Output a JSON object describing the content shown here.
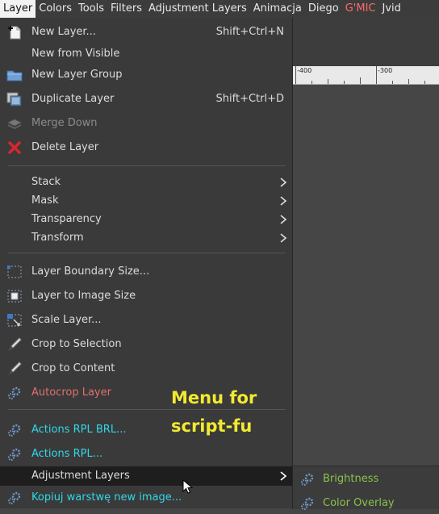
{
  "menubar": {
    "items": [
      "Layer",
      "Colors",
      "Tools",
      "Filters",
      "Adjustment Layers",
      "Animacja",
      "Diego",
      "G'MIC",
      "Jvid"
    ]
  },
  "ruler": {
    "labels": [
      "-400",
      "-300"
    ]
  },
  "annotation": {
    "line1": "Menu for",
    "line2": "script-fu"
  },
  "layer_menu": {
    "new_layer": {
      "label": "New Layer...",
      "shortcut": "Shift+Ctrl+N",
      "icon": "new-layer-icon"
    },
    "new_from_visible": {
      "label": "New from Visible"
    },
    "new_layer_group": {
      "label": "New Layer Group",
      "icon": "folder-icon"
    },
    "duplicate_layer": {
      "label": "Duplicate Layer",
      "shortcut": "Shift+Ctrl+D",
      "icon": "duplicate-icon"
    },
    "merge_down": {
      "label": "Merge Down",
      "icon": "merge-down-icon",
      "enabled": false
    },
    "delete_layer": {
      "label": "Delete Layer",
      "icon": "delete-icon"
    },
    "stack": {
      "label": "Stack"
    },
    "mask": {
      "label": "Mask"
    },
    "transparency": {
      "label": "Transparency"
    },
    "transform": {
      "label": "Transform"
    },
    "layer_boundary_size": {
      "label": "Layer Boundary Size...",
      "icon": "layer-boundary-icon"
    },
    "layer_to_image_size": {
      "label": "Layer to Image Size",
      "icon": "layer-to-image-icon"
    },
    "scale_layer": {
      "label": "Scale Layer...",
      "icon": "scale-icon"
    },
    "crop_to_selection": {
      "label": "Crop to Selection",
      "icon": "knife-icon"
    },
    "crop_to_content": {
      "label": "Crop to Content",
      "icon": "knife-icon"
    },
    "autocrop_layer": {
      "label": "Autocrop Layer",
      "icon": "gear-icon"
    },
    "actions_rpl_brl": {
      "label": "Actions RPL BRL...",
      "icon": "gear-icon"
    },
    "actions_rpl": {
      "label": "Actions RPL...",
      "icon": "gear-icon"
    },
    "adjustment_layers": {
      "label": "Adjustment Layers"
    },
    "kopiuj": {
      "label": "Kopiuj warstwę new image...",
      "icon": "gear-icon"
    }
  },
  "submenu": {
    "brightness": {
      "label": "Brightness",
      "icon": "gear-icon"
    },
    "color_overlay": {
      "label": "Color Overlay",
      "icon": "gear-icon"
    }
  },
  "colors": {
    "script_red": "#e26f6f",
    "script_cyan": "#2fd8e8",
    "submenu_green": "#88c34a",
    "annotation_yellow": "#f2ea2f",
    "gmic_red": "#ff6a6a"
  }
}
